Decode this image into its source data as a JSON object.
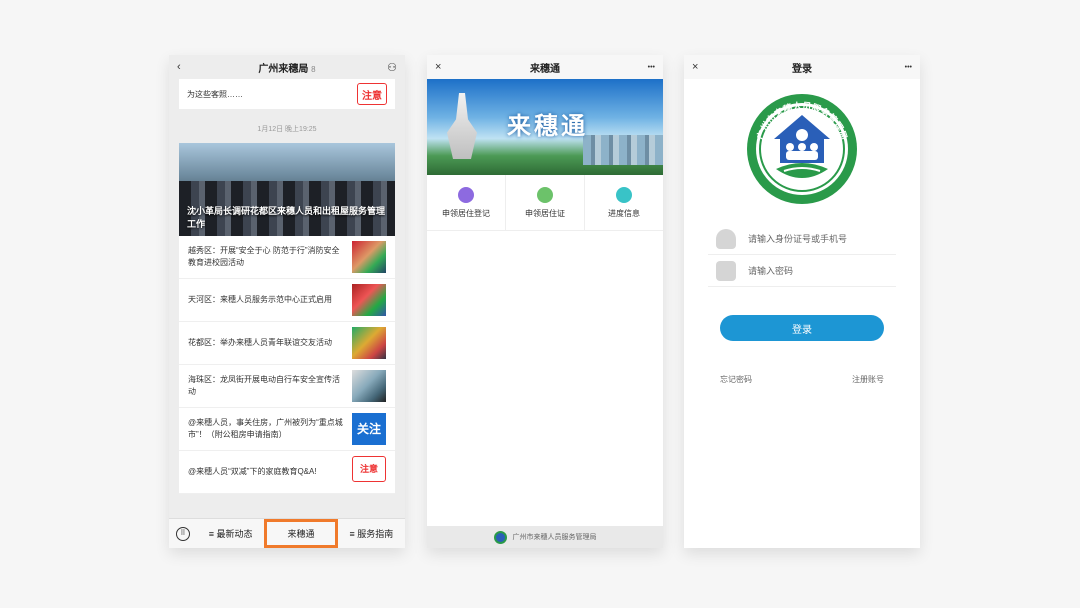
{
  "phone1": {
    "title": "广州来穗局",
    "title_mark": "8",
    "top_excerpt": "为这些客照……",
    "notice_glyph": "注意",
    "timestamp": "1月12日 晚上19:25",
    "hero_caption": "沈小革局长调研花都区来穗人员和出租屋服务管理工作",
    "articles": [
      {
        "text": "越秀区：开展“安全于心 防范于行”消防安全教育进校园活动",
        "thumb": ""
      },
      {
        "text": "天河区：来穗人员服务示范中心正式启用",
        "thumb": ""
      },
      {
        "text": "花都区：举办来穗人员青年联谊交友活动",
        "thumb": ""
      },
      {
        "text": "海珠区：龙凤街开展电动自行车安全宣传活动",
        "thumb": ""
      },
      {
        "text": "@来穗人员，事关住房，广州被列为“重点城市”！（附公租房申请指南）",
        "thumb": "关注"
      },
      {
        "text": "@来穗人员“双减”下的家庭教育Q&A!",
        "thumb": "注意"
      }
    ],
    "tabs": [
      "≡ 最新动态",
      "来穗通",
      "≡ 服务指南"
    ]
  },
  "phone2": {
    "title": "来穗通",
    "banner_text": "来穗通",
    "menu": [
      {
        "label": "申领居住登记",
        "color": "#8d6ae0"
      },
      {
        "label": "申领居住证",
        "color": "#6cc26a"
      },
      {
        "label": "进度信息",
        "color": "#39c3c7"
      }
    ],
    "footer": "广州市来穗人员服务管理局"
  },
  "phone3": {
    "title": "登录",
    "logo_text": "广州市来穗人员服务管理局",
    "id_placeholder": "请输入身份证号或手机号",
    "pwd_placeholder": "请输入密码",
    "login_button": "登录",
    "forgot": "忘记密码",
    "register": "注册账号"
  },
  "icons": {
    "back": "‹",
    "close": "×",
    "more": "•••",
    "person": "⚇"
  },
  "colors": {
    "accent_orange": "#f07a2b",
    "login_blue": "#1d96d4",
    "logo_green": "#2a9a4a",
    "logo_blue": "#2a5fb8"
  }
}
